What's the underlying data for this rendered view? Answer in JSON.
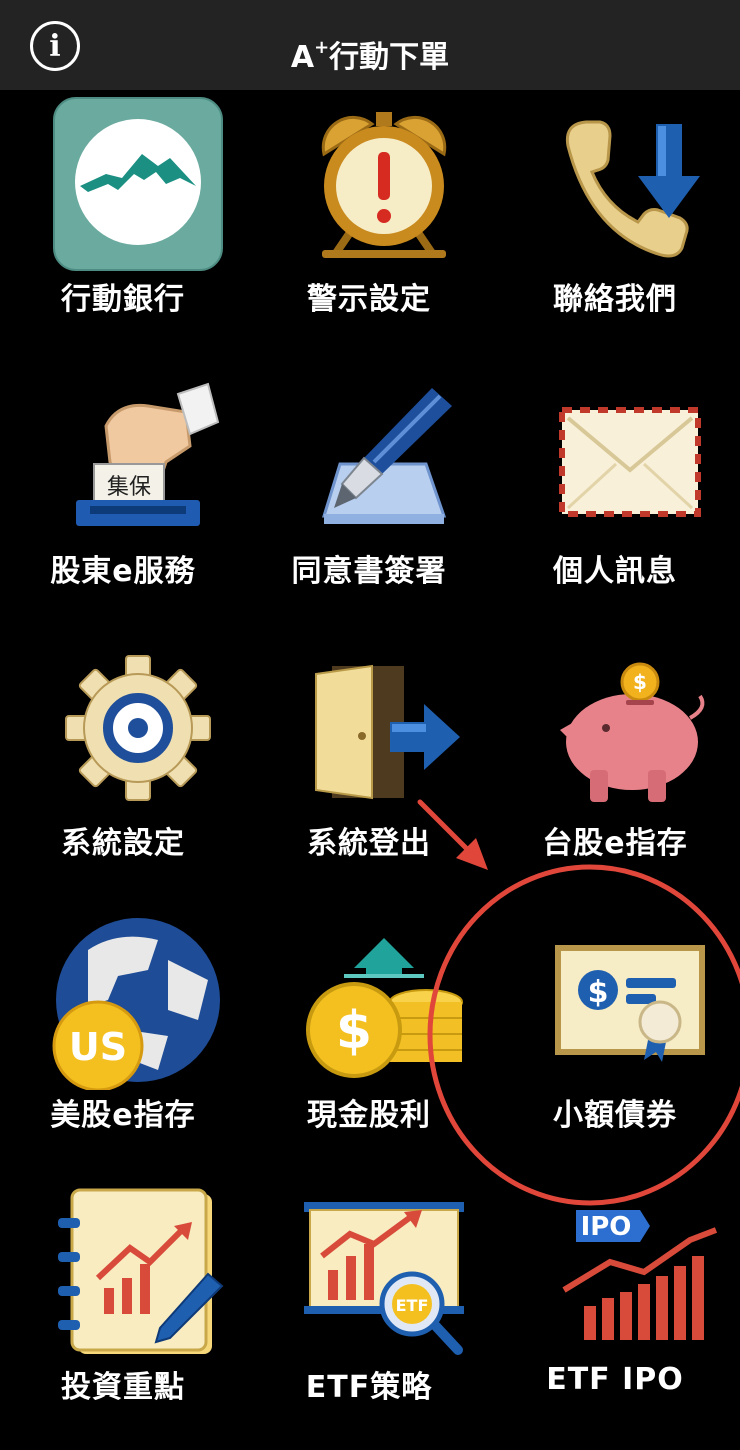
{
  "header": {
    "title_prefix": "A",
    "title_sup": "+",
    "title_main": "行動下單",
    "info_glyph": "i"
  },
  "tiles": [
    {
      "label": "行動銀行",
      "icon": "mountain-logo-icon"
    },
    {
      "label": "警示設定",
      "icon": "alarm-clock-icon"
    },
    {
      "label": "聯絡我們",
      "icon": "phone-icon"
    },
    {
      "label": "股東e服務",
      "icon": "vote-hand-icon",
      "stamp_text": "集保"
    },
    {
      "label": "同意書簽署",
      "icon": "fountain-pen-icon"
    },
    {
      "label": "個人訊息",
      "icon": "envelope-icon"
    },
    {
      "label": "系統設定",
      "icon": "gear-icon"
    },
    {
      "label": "系統登出",
      "icon": "logout-door-icon"
    },
    {
      "label": "台股e指存",
      "icon": "piggy-bank-icon"
    },
    {
      "label": "美股e指存",
      "icon": "globe-us-icon",
      "badge_text": "US"
    },
    {
      "label": "現金股利",
      "icon": "coins-dividend-icon"
    },
    {
      "label": "小額債券",
      "icon": "bond-certificate-icon"
    },
    {
      "label": "投資重點",
      "icon": "notebook-chart-icon"
    },
    {
      "label": "ETF策略",
      "icon": "etf-board-icon",
      "badge_text": "ETF"
    },
    {
      "label": "ETF IPO",
      "icon": "ipo-chart-icon",
      "badge_text": "IPO"
    }
  ],
  "colors": {
    "topbar": "#232323",
    "annotation": "#e0473a",
    "background": "#000000"
  }
}
